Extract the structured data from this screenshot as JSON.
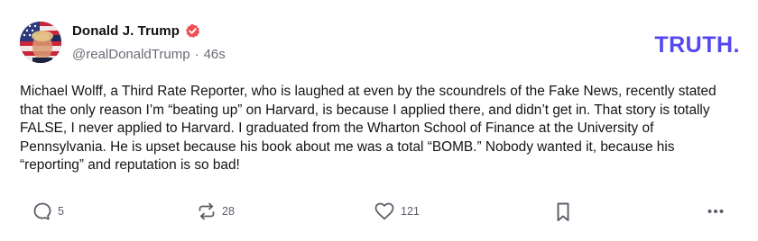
{
  "post": {
    "author": {
      "display_name": "Donald J. Trump",
      "handle": "@realDonaldTrump",
      "separator": "·",
      "time_ago": "46s",
      "verified": true,
      "avatar_icon": "profile-photo-american-flag"
    },
    "brand": {
      "logo_text": "TRUTH.",
      "color": "#5448EE"
    },
    "body_text": "Michael Wolff, a Third Rate Reporter, who is laughed at even by the scoundrels of the Fake News, recently stated that the only reason I’m “beating up” on Harvard, is because I applied there, and didn’t get in. That story is totally FALSE, I never applied to Harvard. I graduated from the Wharton School of Finance at the University of Pennsylvania. He is upset because his book about me was a total “BOMB.” Nobody wanted it, because his “reporting” and reputation is so bad!",
    "actions": {
      "reply": {
        "icon": "comment-icon",
        "count": "5"
      },
      "retruth": {
        "icon": "repost-icon",
        "count": "28"
      },
      "like": {
        "icon": "heart-icon",
        "count": "121"
      },
      "bookmark": {
        "icon": "bookmark-icon"
      },
      "more": {
        "icon": "ellipsis-icon"
      }
    },
    "colors": {
      "verified_badge": "#EF4E54",
      "secondary_text": "#6B6B78",
      "action_icon": "#5C5C68"
    }
  }
}
